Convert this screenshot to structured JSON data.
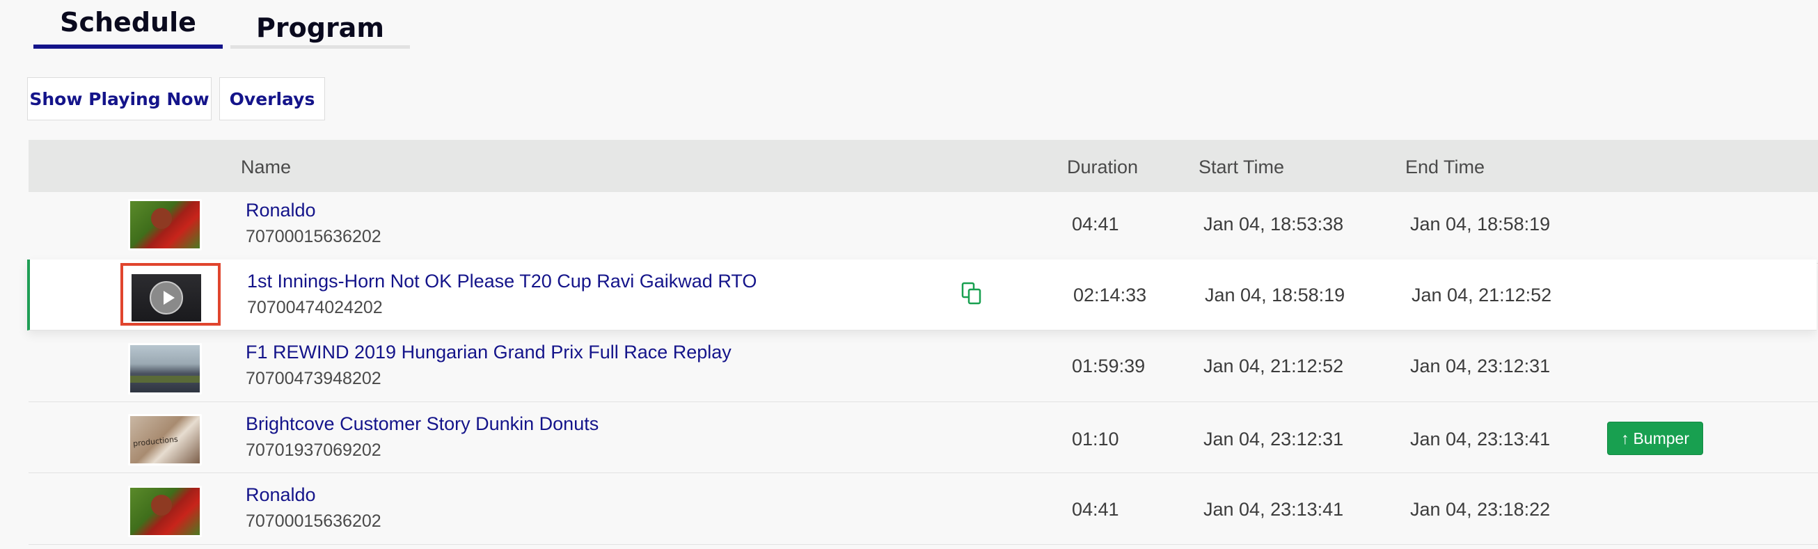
{
  "tabs": [
    {
      "label": "Schedule",
      "active": true
    },
    {
      "label": "Program",
      "active": false
    }
  ],
  "toolbar": {
    "show_playing_label": "Show Playing Now",
    "overlays_label": "Overlays"
  },
  "table": {
    "columns": {
      "name": "Name",
      "duration": "Duration",
      "start": "Start Time",
      "end": "End Time"
    },
    "rows": [
      {
        "title": "Ronaldo",
        "id": "70700015636202",
        "duration": "04:41",
        "start": "Jan 04, 18:53:38",
        "end": "Jan 04, 18:58:19",
        "thumb": "ronaldo"
      },
      {
        "title": "1st Innings-Horn Not OK Please T20 Cup Ravi Gaikwad RTO",
        "id": "70700474024202",
        "duration": "02:14:33",
        "start": "Jan 04, 18:58:19",
        "end": "Jan 04, 21:12:52",
        "thumb": "cricket",
        "playing": true
      },
      {
        "title": "F1 REWIND 2019 Hungarian Grand Prix Full Race Replay",
        "id": "70700473948202",
        "duration": "01:59:39",
        "start": "Jan 04, 21:12:52",
        "end": "Jan 04, 23:12:31",
        "thumb": "f1"
      },
      {
        "title": "Brightcove Customer Story Dunkin Donuts",
        "id": "70701937069202",
        "duration": "01:10",
        "start": "Jan 04, 23:12:31",
        "end": "Jan 04, 23:13:41",
        "thumb": "dunkin",
        "badge": "Bumper",
        "thumb_text": "productions"
      },
      {
        "title": "Ronaldo",
        "id": "70700015636202",
        "duration": "04:41",
        "start": "Jan 04, 23:13:41",
        "end": "Jan 04, 23:18:22",
        "thumb": "ronaldo"
      }
    ]
  },
  "colors": {
    "accent": "#14148a",
    "playing_border": "#1f9d55",
    "bumper": "#18a050",
    "focus_box": "#e0452e"
  },
  "icons": {
    "copy": "copy-icon",
    "play": "play-icon",
    "bumper_arrow": "arrow-up-icon"
  }
}
